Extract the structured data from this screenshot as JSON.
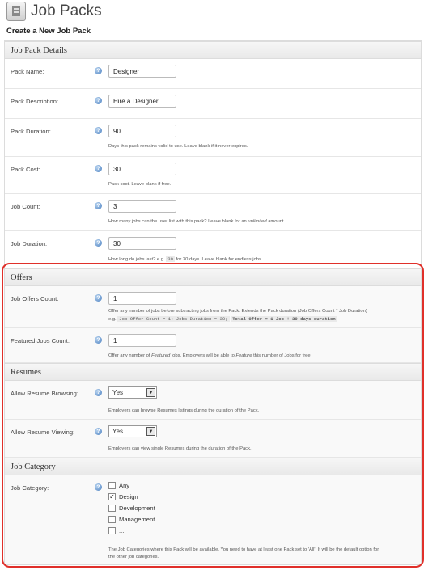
{
  "page": {
    "title": "Job Packs",
    "subtitle": "Create a New Job Pack"
  },
  "sections": {
    "details": "Job Pack Details",
    "offers": "Offers",
    "resumes": "Resumes",
    "category": "Job Category"
  },
  "fields": {
    "pack_name": {
      "label": "Pack Name:",
      "value": "Designer"
    },
    "pack_description": {
      "label": "Pack Description:",
      "value": "Hire a Designer"
    },
    "pack_duration": {
      "label": "Pack Duration:",
      "value": "90",
      "desc": "Days this pack remains valid to use. Leave blank if it never expires."
    },
    "pack_cost": {
      "label": "Pack Cost:",
      "value": "30",
      "desc": "Pack cost. Leave blank if free."
    },
    "job_count": {
      "label": "Job Count:",
      "value": "3",
      "desc_pre": "How many jobs can the user list with this pack? Leave blank for an ",
      "desc_em": "unlimited",
      "desc_post": " amount."
    },
    "job_duration": {
      "label": "Job Duration:",
      "value": "30",
      "desc_pre": "How long do jobs last? e.g. ",
      "desc_code": "30",
      "desc_post": " for 30 days. Leave blank for endless jobs."
    },
    "job_offers_count": {
      "label": "Job Offers Count:",
      "value": "1",
      "desc_line1": "Offer any number of jobs before subtracting jobs from the Pack. Extends the Pack duration (Job Offers Count * Job Duration)",
      "desc_eg": "e.g.",
      "code1": "Job Offer Count = 1; Jobs Duration = 30;",
      "code2": "Total Offer = 1 Job + 30 days duration"
    },
    "featured_jobs_count": {
      "label": "Featured Jobs Count:",
      "value": "1",
      "desc_a": "Offer any number of ",
      "desc_em1": "Featured",
      "desc_b": " jobs. Employers will be able to ",
      "desc_em2": "Feature",
      "desc_c": " this number of Jobs for free."
    },
    "allow_resume_browsing": {
      "label": "Allow Resume Browsing:",
      "value": "Yes",
      "desc": "Employers can browse Resumes listings during the duration of the Pack."
    },
    "allow_resume_viewing": {
      "label": "Allow Resume Viewing:",
      "value": "Yes",
      "desc": "Employers can view single Resumes during the duration of the Pack."
    },
    "job_category": {
      "label": "Job Category:",
      "options": [
        {
          "label": "Any",
          "checked": false
        },
        {
          "label": "Design",
          "checked": true
        },
        {
          "label": "Development",
          "checked": false
        },
        {
          "label": "Management",
          "checked": false
        },
        {
          "label": "...",
          "checked": false
        }
      ],
      "desc_line1": "The Job Categories where this Pack will be available. You need to have at least one Pack set to 'All'. It will be the default option for",
      "desc_line2": "the other job categories."
    }
  },
  "icons": {
    "help": "help-icon",
    "page": "job-packs-icon"
  },
  "colors": {
    "highlight": "#e0302a",
    "help": "#4a7fc0"
  },
  "glyphs": {
    "help": "?",
    "check": "✓",
    "arrow": "▼"
  }
}
